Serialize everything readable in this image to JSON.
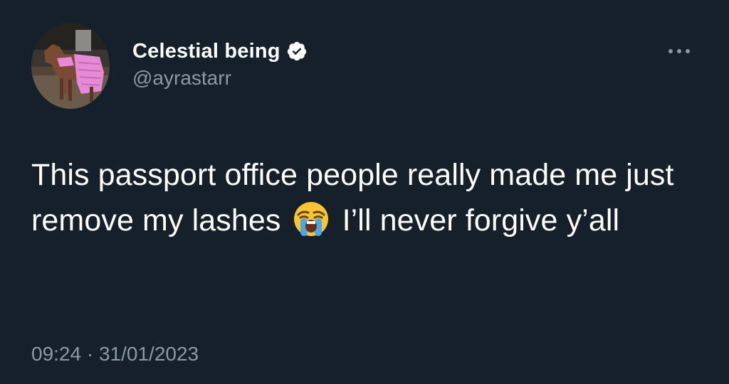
{
  "author": {
    "display_name": "Celestial being",
    "handle": "@ayrastarr",
    "verified_icon": "verified-badge-icon",
    "avatar_description_icon": "avatar"
  },
  "tweet": {
    "text_before_emoji": "This passport office people really made me just remove my lashes",
    "emoji_icon": "loudly-crying-face-emoji",
    "text_after_emoji": "I’ll never forgive y’all"
  },
  "meta": {
    "time": "09:24",
    "separator": "·",
    "date": "31/01/2023"
  },
  "menu": {
    "icon": "more-options-icon"
  },
  "colors": {
    "background": "#15202b",
    "primary_text": "#ffffff",
    "secondary_text": "#8b98a5",
    "badge": "#ffffff"
  }
}
